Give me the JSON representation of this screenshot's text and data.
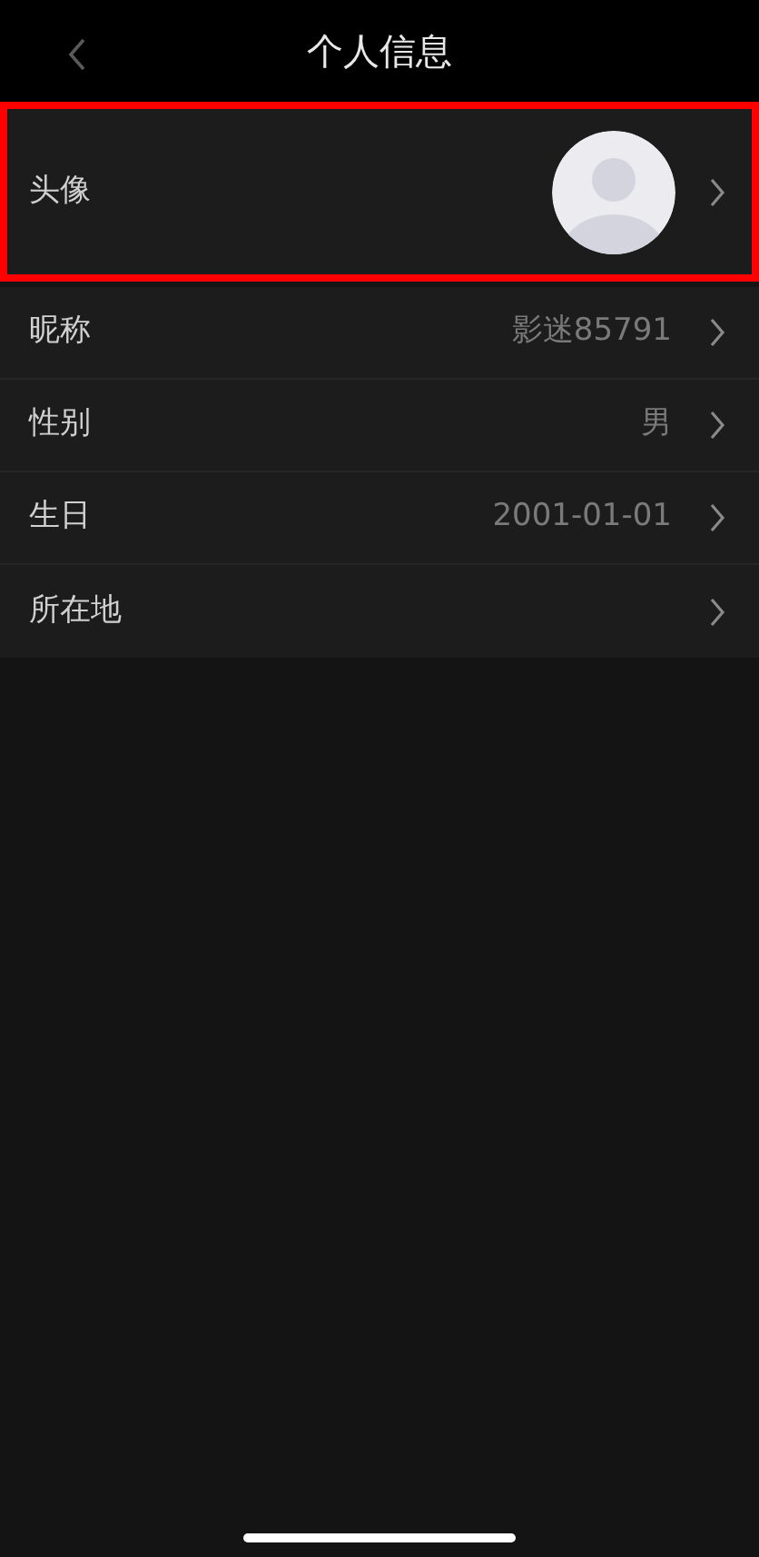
{
  "header": {
    "title": "个人信息"
  },
  "avatar_row": {
    "label": "头像",
    "highlighted": true
  },
  "rows": [
    {
      "label": "昵称",
      "value": "影迷85791"
    },
    {
      "label": "性别",
      "value": "男"
    },
    {
      "label": "生日",
      "value": "2001-01-01"
    },
    {
      "label": "所在地"
    }
  ]
}
